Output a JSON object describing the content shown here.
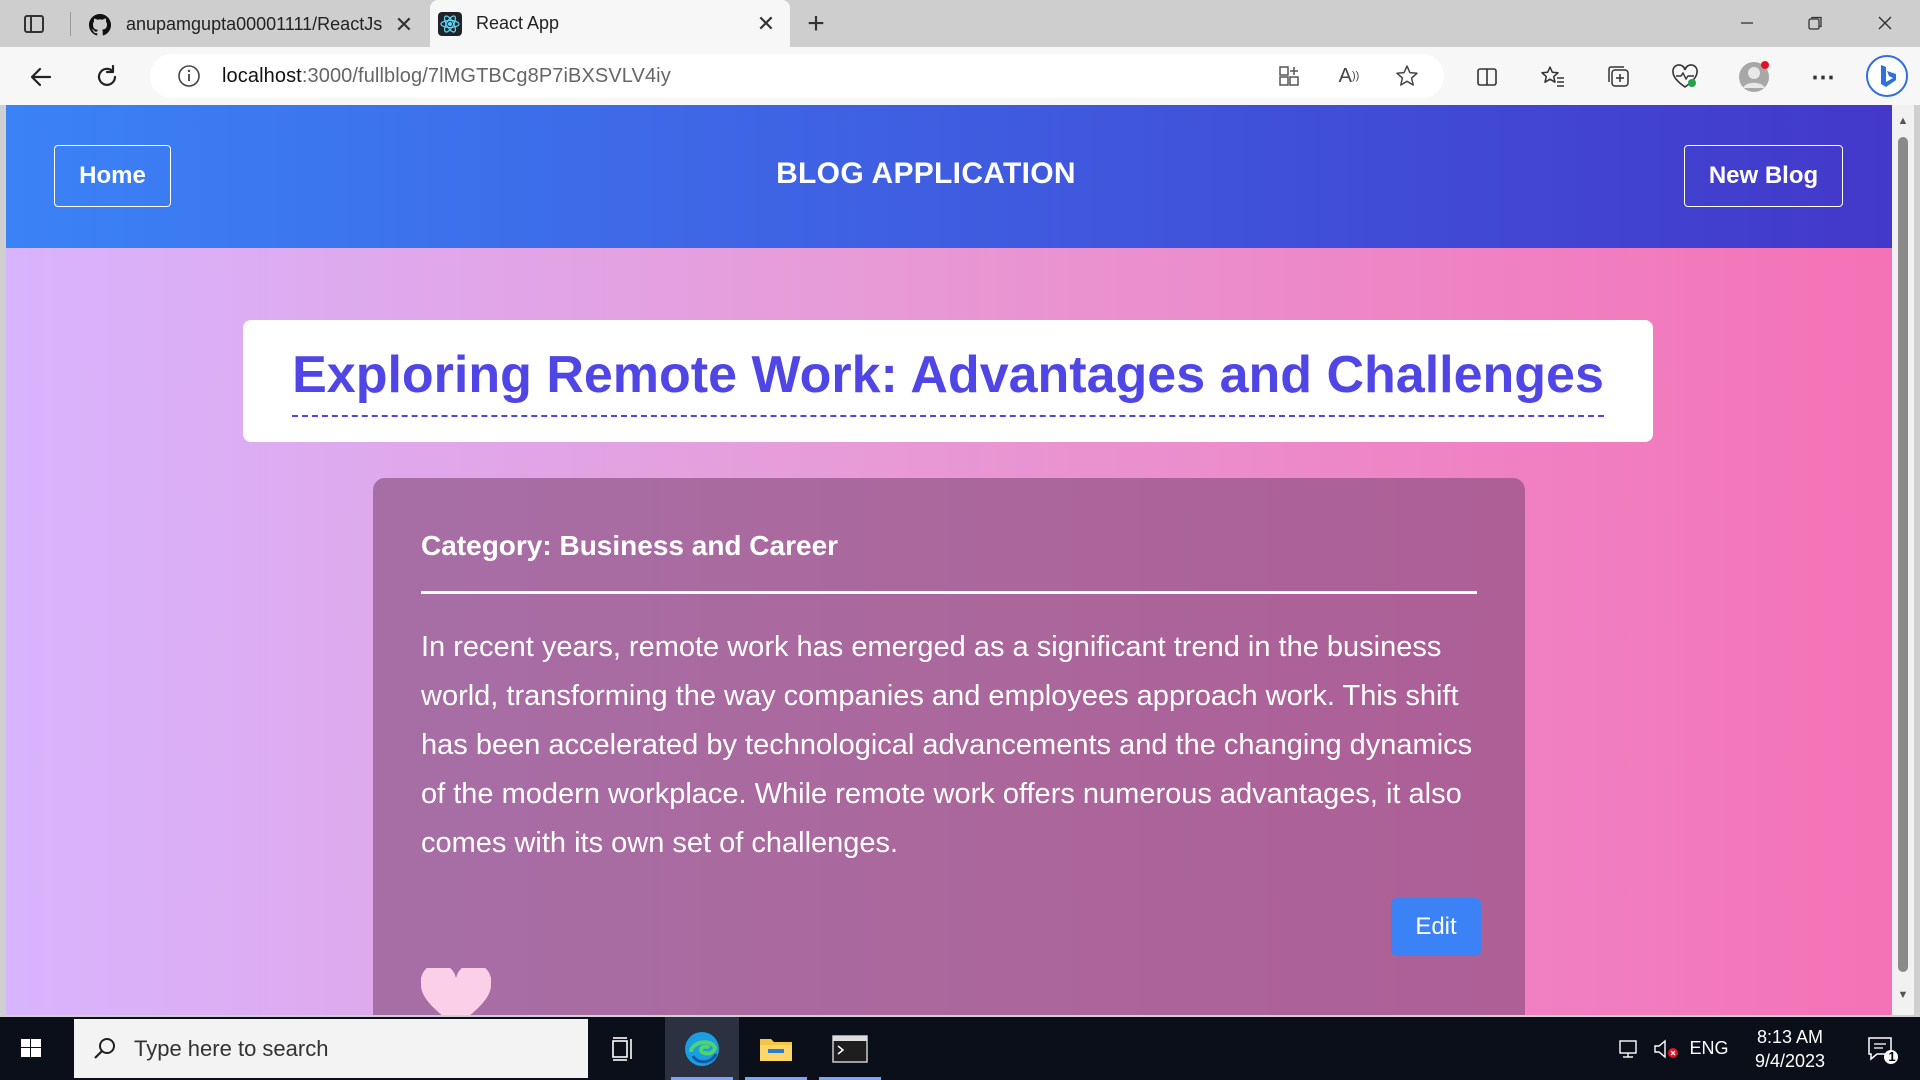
{
  "browser": {
    "tabs": [
      {
        "title": "anupamgupta00001111/ReactJs",
        "icon": "github-icon",
        "active": false
      },
      {
        "title": "React App",
        "icon": "react-icon",
        "active": true
      }
    ],
    "address": {
      "host": "localhost",
      "path": ":3000/fullblog/7lMGTBCg8P7iBXSVLV4iy"
    }
  },
  "header": {
    "home_label": "Home",
    "title": "BLOG APPLICATION",
    "new_blog_label": "New Blog"
  },
  "post": {
    "title": "Exploring Remote Work: Advantages and Challenges",
    "category": "Category: Business and Career",
    "content": "In recent years, remote work has emerged as a significant trend in the business world, transforming the way companies and employees approach work. This shift has been accelerated by technological advancements and the changing dynamics of the modern workplace. While remote work offers numerous advantages, it also comes with its own set of challenges.",
    "edit_label": "Edit"
  },
  "taskbar": {
    "search_placeholder": "Type here to search",
    "language": "ENG",
    "time": "8:13 AM",
    "date": "9/4/2023",
    "notification_count": "1"
  },
  "colors": {
    "header_gradient_start": "#3b82f6",
    "header_gradient_end": "#4338ca",
    "title_color": "#4f46e5",
    "edit_button": "#3b82f6",
    "heart": "#fbcfe8"
  }
}
